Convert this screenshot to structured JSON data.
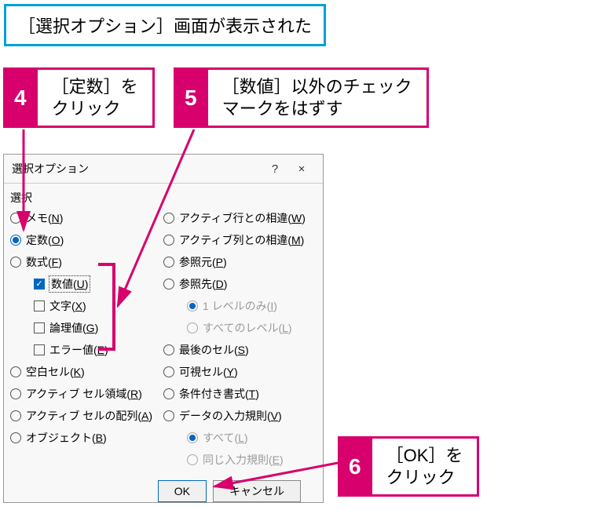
{
  "caption": "［選択オプション］画面が表示された",
  "callouts": {
    "c4": {
      "num": "4",
      "text": "［定数］を\nクリック"
    },
    "c5": {
      "num": "5",
      "text": "［数値］以外のチェック\nマークをはずす"
    },
    "c6": {
      "num": "6",
      "text": "［OK］を\nクリック"
    }
  },
  "dialog": {
    "title": "選択オプション",
    "help": "?",
    "close": "×",
    "section": "選択",
    "left": {
      "memo": {
        "label": "メモ(",
        "accel": "N",
        "label2": ")"
      },
      "const": {
        "label": "定数(",
        "accel": "O",
        "label2": ")"
      },
      "formula": {
        "label": "数式(",
        "accel": "F",
        "label2": ")"
      },
      "num": {
        "label": "数値(",
        "accel": "U",
        "label2": ")"
      },
      "text": {
        "label": "文字(",
        "accel": "X",
        "label2": ")"
      },
      "logic": {
        "label": "論理値(",
        "accel": "G",
        "label2": ")"
      },
      "err": {
        "label": "エラー値(",
        "accel": "E",
        "label2": ")"
      },
      "blank": {
        "label": "空白セル(",
        "accel": "K",
        "label2": ")"
      },
      "region": {
        "label": "アクティブ セル領域(",
        "accel": "R",
        "label2": ")"
      },
      "array": {
        "label": "アクティブ セルの配列(",
        "accel": "A",
        "label2": ")"
      },
      "obj": {
        "label": "オブジェクト(",
        "accel": "B",
        "label2": ")"
      }
    },
    "right": {
      "rowdiff": {
        "label": "アクティブ行との相違(",
        "accel": "W",
        "label2": ")"
      },
      "coldiff": {
        "label": "アクティブ列との相違(",
        "accel": "M",
        "label2": ")"
      },
      "prec": {
        "label": "参照元(",
        "accel": "P",
        "label2": ")"
      },
      "dep": {
        "label": "参照先(",
        "accel": "D",
        "label2": ")"
      },
      "lvl1": {
        "label": "1 レベルのみ(",
        "accel": "I",
        "label2": ")"
      },
      "lvlall": {
        "label": "すべてのレベル(",
        "accel": "L",
        "label2": ")"
      },
      "last": {
        "label": "最後のセル(",
        "accel": "S",
        "label2": ")"
      },
      "vis": {
        "label": "可視セル(",
        "accel": "Y",
        "label2": ")"
      },
      "cf": {
        "label": "条件付き書式(",
        "accel": "T",
        "label2": ")"
      },
      "dv": {
        "label": "データの入力規則(",
        "accel": "V",
        "label2": ")"
      },
      "all": {
        "label": "すべて(",
        "accel": "L",
        "label2": ")"
      },
      "same": {
        "label": "同じ入力規則(",
        "accel": "E",
        "label2": ")"
      }
    },
    "ok": "OK",
    "cancel": "キャンセル"
  }
}
